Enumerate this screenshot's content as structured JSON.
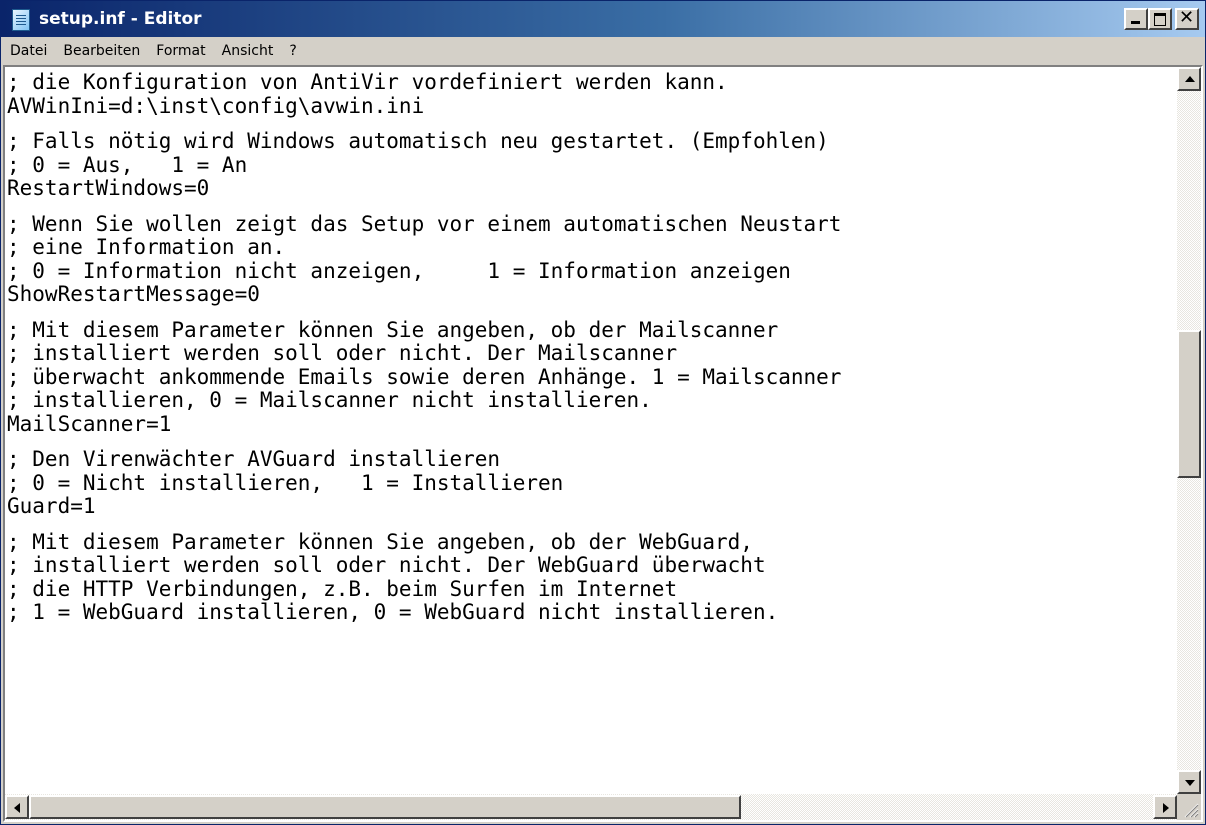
{
  "window": {
    "title": "setup.inf - Editor",
    "icon": "notepad-icon"
  },
  "caption_buttons": {
    "minimize_icon": "minimize-icon",
    "maximize_icon": "maximize-icon",
    "close_icon": "close-icon"
  },
  "menu": {
    "items": [
      {
        "label": "Datei"
      },
      {
        "label": "Bearbeiten"
      },
      {
        "label": "Format"
      },
      {
        "label": "Ansicht"
      },
      {
        "label": "?"
      }
    ]
  },
  "editor": {
    "lines": [
      "; die Konfiguration von AntiVir vordefiniert werden kann.",
      "AVWinIni=d:\\inst\\config\\avwin.ini",
      "",
      "; Falls nötig wird Windows automatisch neu gestartet. (Empfohlen)",
      "; 0 = Aus,   1 = An",
      "RestartWindows=0",
      "",
      "; Wenn Sie wollen zeigt das Setup vor einem automatischen Neustart",
      "; eine Information an.",
      "; 0 = Information nicht anzeigen,     1 = Information anzeigen",
      "ShowRestartMessage=0",
      "",
      "; Mit diesem Parameter können Sie angeben, ob der Mailscanner",
      "; installiert werden soll oder nicht. Der Mailscanner",
      "; überwacht ankommende Emails sowie deren Anhänge. 1 = Mailscanner",
      "; installieren, 0 = Mailscanner nicht installieren.",
      "MailScanner=1",
      "",
      "; Den Virenwächter AVGuard installieren",
      "; 0 = Nicht installieren,   1 = Installieren",
      "Guard=1",
      "",
      "; Mit diesem Parameter können Sie angeben, ob der WebGuard,",
      "; installiert werden soll oder nicht. Der WebGuard überwacht",
      "; die HTTP Verbindungen, z.B. beim Surfen im Internet",
      "; 1 = WebGuard installieren, 0 = WebGuard nicht installieren."
    ]
  },
  "scrollbars": {
    "vertical_position": 0.45,
    "horizontal_position": 0.0
  }
}
